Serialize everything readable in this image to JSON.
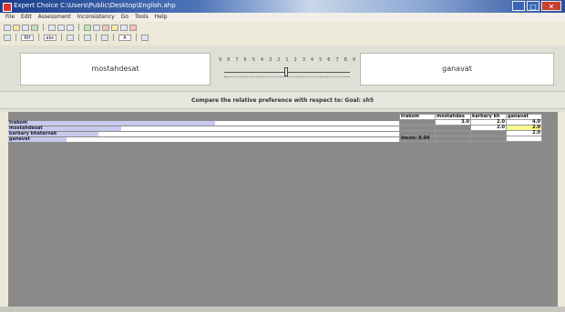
{
  "window": {
    "title": "Expert Choice   C:\\Users\\Public\\Desktop\\English.ahp",
    "btn_min": "_",
    "btn_max": "□",
    "btn_close": "✕"
  },
  "menu": [
    "File",
    "Edit",
    "Assessment",
    "Inconsistency",
    "Go",
    "Tools",
    "Help"
  ],
  "toolbar2": {
    "label_rh": "RH",
    "label_abc": "abc",
    "label_a": "A"
  },
  "comparison": {
    "left_item": "mostahdesat",
    "right_item": "ganavat",
    "scale": [
      "9",
      "8",
      "7",
      "6",
      "5",
      "4",
      "3",
      "2",
      "1",
      "2",
      "3",
      "4",
      "5",
      "6",
      "7",
      "8",
      "9"
    ],
    "slider_value": "1"
  },
  "prompt": "Compare the relative preference with respect to: Goal: sh5",
  "matrix": {
    "headers": [
      "trakom",
      "mostahdes",
      "karbary kh",
      "ganavat"
    ],
    "rows": [
      {
        "label": "trakom",
        "bar_fraction": 0.53
      },
      {
        "label": "mostahdesat",
        "bar_fraction": 0.29
      },
      {
        "label": "karbary khatarnak",
        "bar_fraction": 0.23
      },
      {
        "label": "ganavat",
        "bar_fraction": 0.15
      }
    ],
    "cells": [
      [
        "",
        "3.0",
        "2.0",
        "4.0"
      ],
      [
        "",
        "",
        "2.0",
        "2.0"
      ],
      [
        "",
        "",
        "",
        "2.0"
      ],
      [
        "",
        "",
        "",
        ""
      ]
    ],
    "inconsistency": "Incon: 0.04",
    "highlight_color": "#fbf78a"
  },
  "colors": {
    "bar": "#c7c9ee",
    "background": "#8a8a8a"
  }
}
